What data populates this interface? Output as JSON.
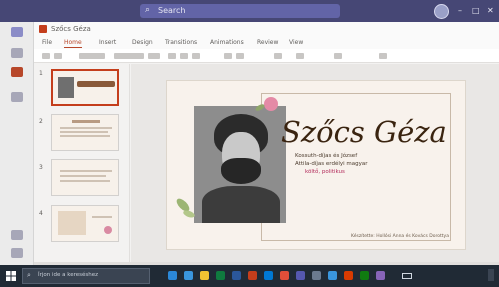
{
  "teams": {
    "search_placeholder": "Search",
    "minimize": "–",
    "restore": "□",
    "close": "✕"
  },
  "ppt": {
    "doc_title": "Szőcs Géza",
    "tabs": [
      "File",
      "Home",
      "Insert",
      "Design",
      "Transitions",
      "Animations",
      "Review",
      "View"
    ],
    "active_tab": "Home"
  },
  "thumbnails": {
    "numbers": [
      "1",
      "2",
      "3",
      "4"
    ]
  },
  "slide": {
    "title": "Szőcs Géza",
    "subtitle_lines": [
      "Kossuth-díjas és József",
      "Attila-díjas erdélyi magyar",
      "költő, politikus"
    ],
    "caption": "Készítette: Hollósi Anna és Kovács Dorottya"
  },
  "taskbar": {
    "search_placeholder": "Írjon ide a kereséshez"
  },
  "colors": {
    "teams_bar": "#464775",
    "ppt_accent": "#c43e1c",
    "slide_bg": "#f8f2ec",
    "title_color": "#3a2410"
  }
}
